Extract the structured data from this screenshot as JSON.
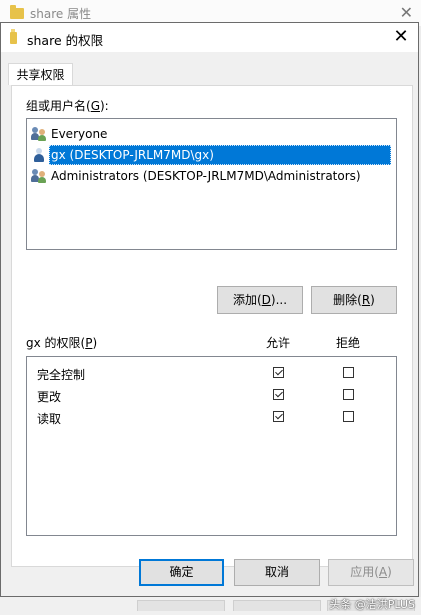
{
  "background_window": {
    "title": "share 属性"
  },
  "dialog": {
    "title": "share 的权限",
    "tab": "共享权限",
    "users_label": "组或用户名(G):",
    "users_label_parts": {
      "pre": "组或用户名(",
      "key": "G",
      "post": "):"
    },
    "users": [
      {
        "name": "Everyone",
        "icon": "group-icon",
        "selected": false
      },
      {
        "name": "gx (DESKTOP-JRLM7MD\\gx)",
        "icon": "user-icon",
        "selected": true
      },
      {
        "name": "Administrators (DESKTOP-JRLM7MD\\Administrators)",
        "icon": "group-icon",
        "selected": false
      }
    ],
    "add_button": {
      "pre": "添加(",
      "key": "D",
      "post": ")..."
    },
    "remove_button": {
      "pre": "删除(",
      "key": "R",
      "post": ")"
    },
    "perm_label": {
      "pre": "gx 的权限(",
      "key": "P",
      "post": ")"
    },
    "allow_header": "允许",
    "deny_header": "拒绝",
    "permissions": [
      {
        "name": "完全控制",
        "allow": true,
        "deny": false
      },
      {
        "name": "更改",
        "allow": true,
        "deny": false
      },
      {
        "name": "读取",
        "allow": true,
        "deny": false
      }
    ],
    "ok_button": "确定",
    "cancel_button": "取消",
    "apply_button": {
      "pre": "应用(",
      "key": "A",
      "post": ")"
    }
  },
  "watermark": "头条 @洁洪PLUS",
  "colors": {
    "selection": "#0078d7",
    "folder": "#e7c24a"
  }
}
